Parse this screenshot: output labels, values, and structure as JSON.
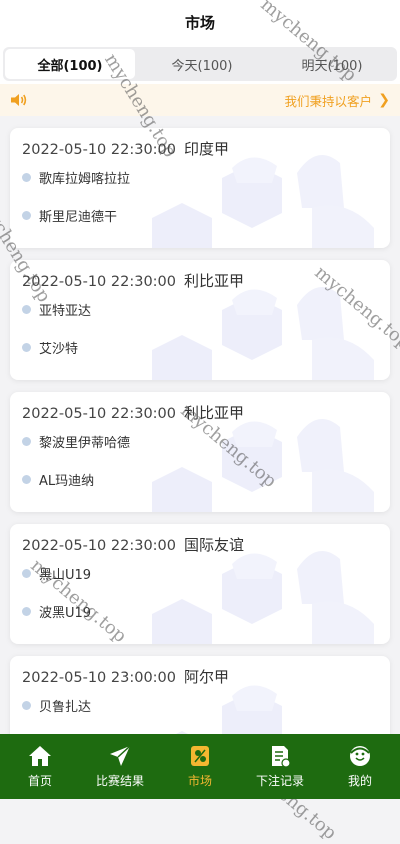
{
  "header": {
    "title": "市场"
  },
  "tabs": [
    {
      "label": "全部(100)",
      "active": true
    },
    {
      "label": "今天(100)",
      "active": false
    },
    {
      "label": "明天(100)",
      "active": false
    }
  ],
  "notice": {
    "text": "我们秉持以客户",
    "icon": "speaker-icon",
    "arrow_icon": "chevron-right-icon",
    "color": "#f0a020"
  },
  "matches": [
    {
      "time": "2022-05-10 22:30:00",
      "league": "印度甲",
      "home": "歌库拉姆喀拉拉",
      "away": "斯里尼迪德干"
    },
    {
      "time": "2022-05-10 22:30:00",
      "league": "利比亚甲",
      "home": "亚特亚达",
      "away": "艾沙特"
    },
    {
      "time": "2022-05-10 22:30:00",
      "league": "利比亚甲",
      "home": "黎波里伊蒂哈德",
      "away": "AL玛迪纳"
    },
    {
      "time": "2022-05-10 22:30:00",
      "league": "国际友谊",
      "home": "黑山U19",
      "away": "波黑U19"
    },
    {
      "time": "2022-05-10 23:00:00",
      "league": "阿尔甲",
      "home": "贝鲁扎达",
      "away": ""
    }
  ],
  "watermark_text": "mycheng.top",
  "tabbar": {
    "items": [
      {
        "label": "首页",
        "icon": "home-icon",
        "active": false
      },
      {
        "label": "比赛结果",
        "icon": "send-icon",
        "active": false
      },
      {
        "label": "市场",
        "icon": "market-icon",
        "active": true
      },
      {
        "label": "下注记录",
        "icon": "bet-record-icon",
        "active": false
      },
      {
        "label": "我的",
        "icon": "profile-icon",
        "active": false
      }
    ],
    "bg_color": "#1e6b10",
    "active_color": "#f4b731"
  }
}
